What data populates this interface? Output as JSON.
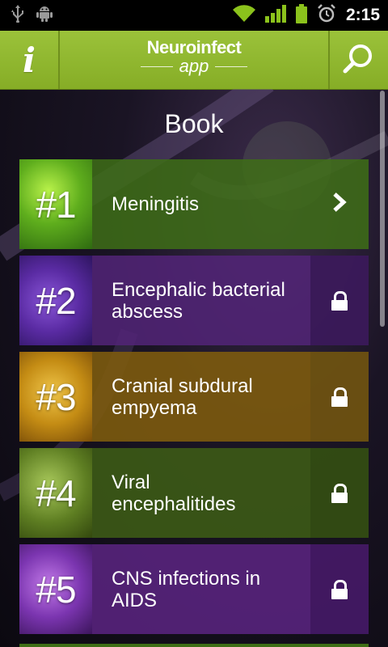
{
  "statusbar": {
    "time": "2:15",
    "icons": [
      "usb-icon",
      "android-debug-icon",
      "wifi-icon",
      "signal-icon",
      "battery-icon",
      "alarm-icon"
    ]
  },
  "header": {
    "logo_top": "Neuroinfect",
    "logo_sub": "app",
    "info_label": "i",
    "accent": "#8fb82f"
  },
  "page": {
    "title": "Book"
  },
  "book": {
    "items": [
      {
        "number": "#1",
        "title": "Meningitis",
        "status": "open"
      },
      {
        "number": "#2",
        "title": "Encephalic bacterial abscess",
        "status": "locked"
      },
      {
        "number": "#3",
        "title": "Cranial subdural empyema",
        "status": "locked"
      },
      {
        "number": "#4",
        "title": "Viral encephalitides",
        "status": "locked"
      },
      {
        "number": "#5",
        "title": "CNS infections in AIDS",
        "status": "locked"
      }
    ]
  }
}
